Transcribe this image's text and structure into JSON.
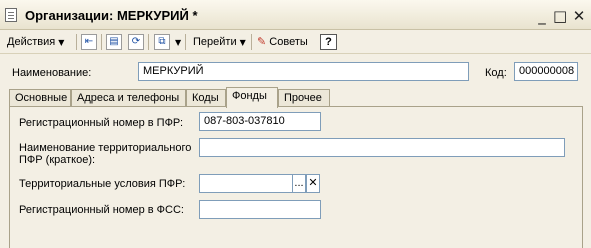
{
  "window": {
    "title": "Организации: МЕРКУРИЙ *",
    "minimize": "_",
    "maximize": "□",
    "close": "✕"
  },
  "toolbar": {
    "actions_label": "Действия",
    "goto_label": "Перейти",
    "tips_label": "Советы",
    "help_label": "?"
  },
  "header": {
    "name_label": "Наименование:",
    "name_value": "МЕРКУРИЙ",
    "code_label": "Код:",
    "code_value": "000000008"
  },
  "tabs": [
    {
      "label": "Основные"
    },
    {
      "label": "Адреса и телефоны"
    },
    {
      "label": "Коды"
    },
    {
      "label": "Фонды",
      "active": true
    },
    {
      "label": "Прочее"
    }
  ],
  "fonds": {
    "pfr_reg_label": "Регистрационный номер в ПФР:",
    "pfr_reg_value": "087-803-037810",
    "pfr_name_label_line1": "Наименование территориального",
    "pfr_name_label_line2": "ПФР (краткое):",
    "pfr_name_value": "",
    "pfr_cond_label": "Территориальные условия ПФР:",
    "pfr_cond_value": "",
    "select_btn": "...",
    "clear_btn": "✕",
    "fss_reg_label": "Регистрационный номер в ФСС:",
    "fss_reg_value": ""
  }
}
